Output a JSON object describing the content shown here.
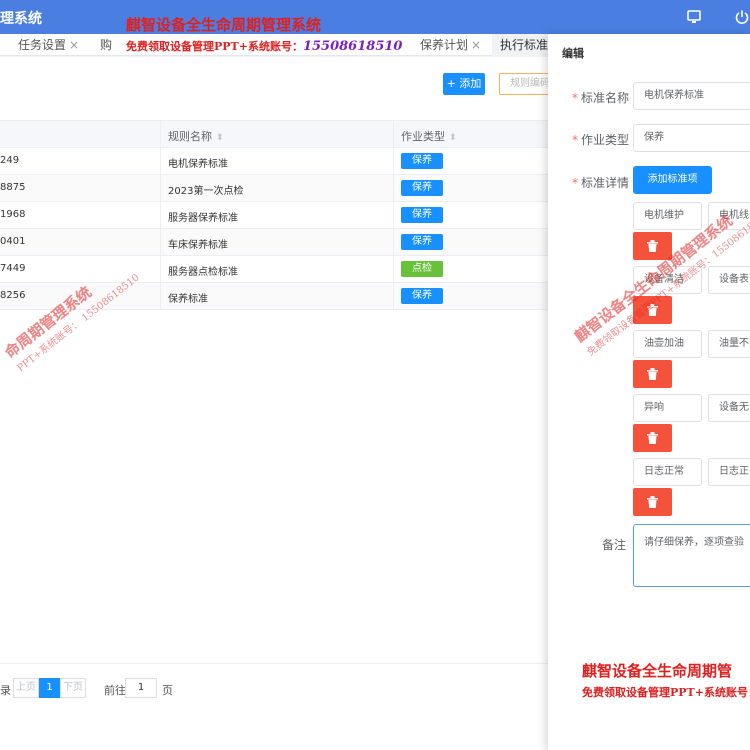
{
  "app": {
    "title": "理系统"
  },
  "tabs": [
    {
      "label": "任务设置",
      "closable": true
    },
    {
      "label": "购",
      "closable": false
    },
    {
      "label": "保养计划",
      "closable": true
    },
    {
      "label": "执行标准",
      "closable": false
    }
  ],
  "toolbar": {
    "add_label": "+ 添加",
    "rule_label": "规则编码"
  },
  "table": {
    "columns": [
      "规则名称",
      "作业类型"
    ],
    "rows": [
      {
        "id": "249",
        "name": "电机保养标准",
        "type": "保养",
        "type_color": "#1890ff"
      },
      {
        "id": "8875",
        "name": "2023第一次点检",
        "type": "保养",
        "type_color": "#1890ff"
      },
      {
        "id": "1968",
        "name": "服务器保养标准",
        "type": "保养",
        "type_color": "#1890ff"
      },
      {
        "id": "0401",
        "name": "车床保养标准",
        "type": "保养",
        "type_color": "#1890ff"
      },
      {
        "id": "7449",
        "name": "服务器点检标准",
        "type": "点检",
        "type_color": "#67c23a"
      },
      {
        "id": "8256",
        "name": "保养标准",
        "type": "保养",
        "type_color": "#1890ff"
      }
    ]
  },
  "pager": {
    "records_suffix": "录",
    "prev": "上页",
    "current": "1",
    "next": "下页",
    "goto_prefix": "前往",
    "goto_value": "1",
    "goto_suffix": "页"
  },
  "drawer": {
    "title": "编辑",
    "name_label": "标准名称",
    "name_value": "电机保养标准",
    "type_label": "作业类型",
    "type_value": "保养",
    "detail_label": "标准详情",
    "add_item_label": "添加标准项",
    "items": [
      {
        "item": "电机维护",
        "standard": "电机线"
      },
      {
        "item": "设备清洁",
        "standard": "设备表"
      },
      {
        "item": "油壶加油",
        "standard": "油量不"
      },
      {
        "item": "异响",
        "standard": "设备无"
      },
      {
        "item": "日志正常",
        "standard": "日志正"
      }
    ],
    "remark_label": "备注",
    "remark_value": "请仔细保养，逐项查验"
  },
  "watermark": {
    "line1": "麒智设备全生命周期管理系统",
    "line2_prefix": "免费领取设备管理PPT+系统账号：",
    "phone": "15508618510",
    "bottom_line1": "麒智设备全生命周期管",
    "bottom_line2": "免费领取设备管理PPT+系统账号：",
    "diag_left_main": "命周期管理系统",
    "diag_left_phone": "15508618510",
    "diag_left_sub": "PPT+系统账号：",
    "diag_right_main": "麒智设备全生命周期管理系统",
    "diag_right_sub": "免费领取设备管理PPT+系统账号：",
    "diag_right_phone": "15508618"
  },
  "colors": {
    "primary": "#1890ff",
    "danger": "#f5523c",
    "success": "#67c23a",
    "header": "#4a7ee0",
    "watermark": "#e02020"
  }
}
